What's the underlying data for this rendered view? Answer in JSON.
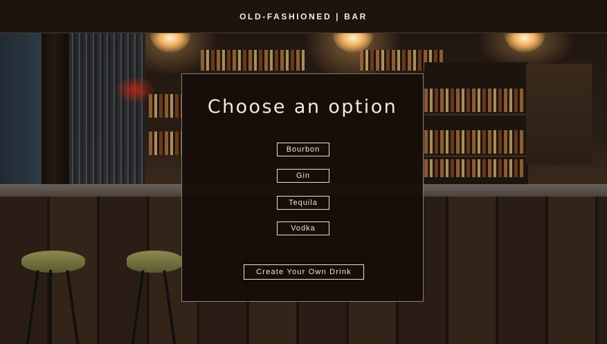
{
  "header": {
    "brand": "OLD-FASHIONED | BAR"
  },
  "modal": {
    "title": "Choose an option",
    "options": [
      {
        "label": "Bourbon"
      },
      {
        "label": "Gin"
      },
      {
        "label": "Tequila"
      },
      {
        "label": "Vodka"
      }
    ],
    "create_label": "Create Your Own Drink"
  },
  "colors": {
    "header_bg": "#1d140f",
    "panel_bg": "#160d08",
    "text": "#f0ebe5",
    "button_border": "#e8e2dc"
  }
}
